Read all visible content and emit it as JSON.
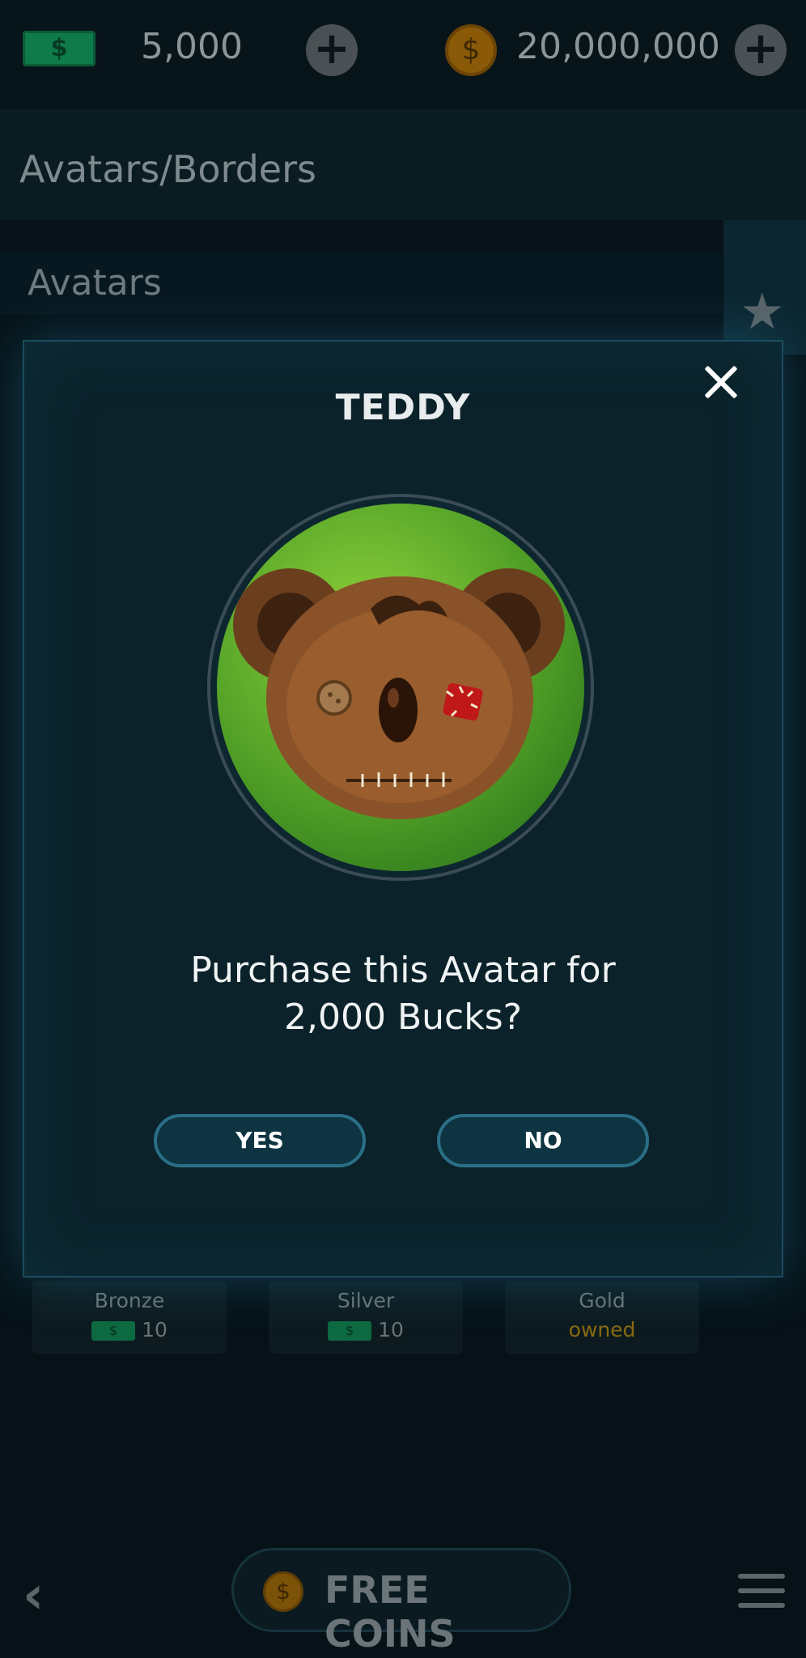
{
  "topbar": {
    "cash_icon": "cash-icon",
    "cash_symbol": "$",
    "cash_amount": "5,000",
    "coin_symbol": "$",
    "coin_amount": "20,000,000",
    "plus_label": "+"
  },
  "section": {
    "title": "Avatars/Borders",
    "avatars_title": "Avatars"
  },
  "cards": [
    {
      "name": "Bronze",
      "price": "10",
      "owned": false
    },
    {
      "name": "Silver",
      "price": "10",
      "owned": false
    },
    {
      "name": "Gold",
      "price": "owned",
      "owned": true
    }
  ],
  "modal": {
    "title": "TEDDY",
    "message_line1": "Purchase this Avatar for",
    "message_line2": "2,000 Bucks?",
    "yes_label": "YES",
    "no_label": "NO"
  },
  "bottom": {
    "back_icon": "chevron-left-icon",
    "free_coins_label": "FREE COINS",
    "coin_symbol": "$",
    "menu_icon": "hamburger-menu-icon"
  },
  "colors": {
    "accent": "#2a6f86",
    "modal_bg": "#0b222b",
    "cash_green": "#0f7a4a",
    "coin_gold": "#8a5a08"
  }
}
